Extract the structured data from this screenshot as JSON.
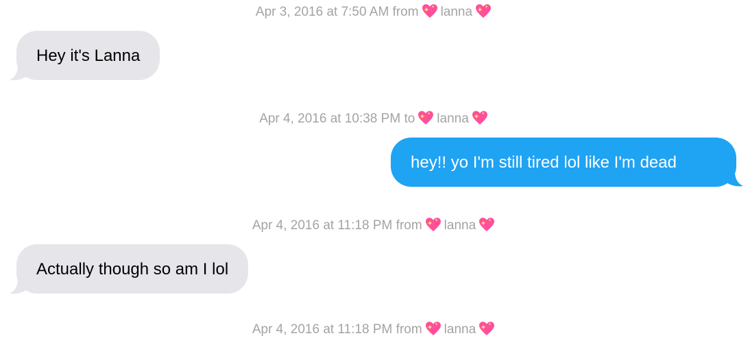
{
  "colors": {
    "received_bubble": "#e5e5ea",
    "sent_bubble": "#1fa3f3",
    "timestamp_text": "#a3a3a3",
    "heart_pink": "#ff4f9a"
  },
  "messages": [
    {
      "timestamp": {
        "date": "Apr 3, 2016 at 7:50 AM",
        "direction": "from",
        "contact": "lanna",
        "icon": "sparkling-heart-icon"
      },
      "type": "received",
      "text": "Hey it's Lanna"
    },
    {
      "timestamp": {
        "date": "Apr 4, 2016 at 10:38 PM",
        "direction": "to",
        "contact": "lanna",
        "icon": "sparkling-heart-icon"
      },
      "type": "sent",
      "text": "hey!! yo I'm still tired lol like I'm dead"
    },
    {
      "timestamp": {
        "date": "Apr 4, 2016 at 11:18 PM",
        "direction": "from",
        "contact": "lanna",
        "icon": "sparkling-heart-icon"
      },
      "type": "received",
      "text": "Actually though so am I lol"
    },
    {
      "timestamp": {
        "date": "Apr 4, 2016 at 11:18 PM",
        "direction": "from",
        "contact": "lanna",
        "icon": "sparkling-heart-icon"
      }
    }
  ]
}
